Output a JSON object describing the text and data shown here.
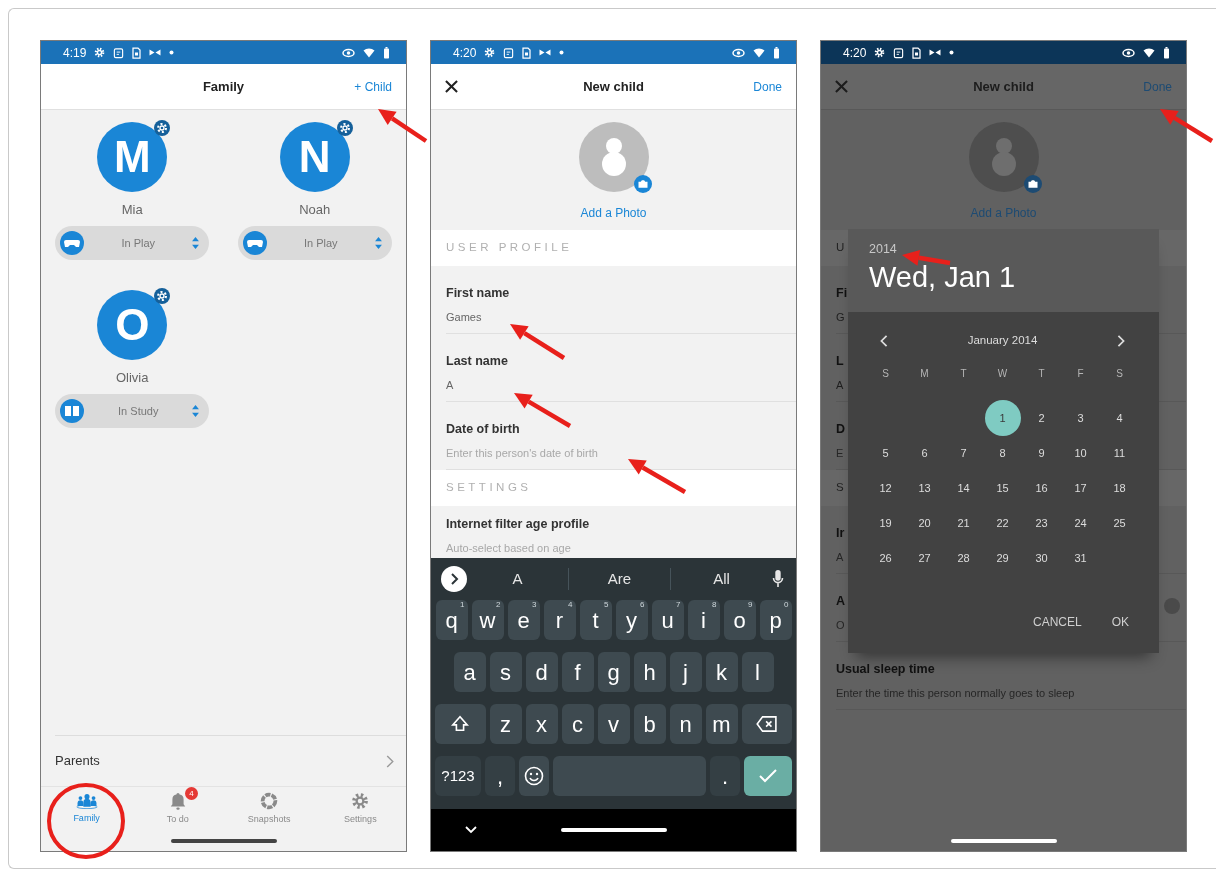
{
  "screens": [
    {
      "kind": "family",
      "status_bar": {
        "time": "4:19"
      },
      "header": {
        "title": "Family",
        "action": "+ Child"
      },
      "children": [
        {
          "initial": "M",
          "name": "Mia",
          "mode": "In Play",
          "kind": "play"
        },
        {
          "initial": "N",
          "name": "Noah",
          "mode": "In Play",
          "kind": "play"
        },
        {
          "initial": "O",
          "name": "Olivia",
          "mode": "In Study",
          "kind": "study"
        }
      ],
      "footer_link": "Parents",
      "bottom_nav": [
        {
          "label": "Family",
          "kind": "family",
          "selected": true
        },
        {
          "label": "To do",
          "kind": "todo",
          "selected": false,
          "badge": "4"
        },
        {
          "label": "Snapshots",
          "kind": "snapshots",
          "selected": false
        },
        {
          "label": "Settings",
          "kind": "settings",
          "selected": false
        }
      ]
    },
    {
      "kind": "form",
      "status_bar": {
        "time": "4:20"
      },
      "header": {
        "title": "New child",
        "action": "Done"
      },
      "photo_label": "Add a Photo",
      "sections": [
        {
          "heading": "USER PROFILE",
          "fields": [
            {
              "kind": "text",
              "label": "First name",
              "value": "Games"
            },
            {
              "kind": "text",
              "label": "Last name",
              "value": "A"
            },
            {
              "kind": "text",
              "label": "Date of birth",
              "placeholder": "Enter this person's date of birth"
            }
          ]
        },
        {
          "heading": "SETTINGS",
          "fields": [
            {
              "kind": "text",
              "label": "Internet filter age profile",
              "placeholder": "Auto-select based on age"
            }
          ]
        }
      ],
      "keyboard": {
        "suggestions": [
          "A",
          "Are",
          "All"
        ],
        "rows": [
          [
            {
              "kind": "char",
              "label": "q",
              "hint": "1"
            },
            {
              "kind": "char",
              "label": "w",
              "hint": "2"
            },
            {
              "kind": "char",
              "label": "e",
              "hint": "3"
            },
            {
              "kind": "char",
              "label": "r",
              "hint": "4"
            },
            {
              "kind": "char",
              "label": "t",
              "hint": "5"
            },
            {
              "kind": "char",
              "label": "y",
              "hint": "6"
            },
            {
              "kind": "char",
              "label": "u",
              "hint": "7"
            },
            {
              "kind": "char",
              "label": "i",
              "hint": "8"
            },
            {
              "kind": "char",
              "label": "o",
              "hint": "9"
            },
            {
              "kind": "char",
              "label": "p",
              "hint": "0"
            }
          ],
          [
            {
              "kind": "char",
              "label": "a"
            },
            {
              "kind": "char",
              "label": "s"
            },
            {
              "kind": "char",
              "label": "d"
            },
            {
              "kind": "char",
              "label": "f"
            },
            {
              "kind": "char",
              "label": "g"
            },
            {
              "kind": "char",
              "label": "h"
            },
            {
              "kind": "char",
              "label": "j"
            },
            {
              "kind": "char",
              "label": "k"
            },
            {
              "kind": "char",
              "label": "l"
            }
          ],
          [
            {
              "kind": "shift"
            },
            {
              "kind": "char",
              "label": "z"
            },
            {
              "kind": "char",
              "label": "x"
            },
            {
              "kind": "char",
              "label": "c"
            },
            {
              "kind": "char",
              "label": "v"
            },
            {
              "kind": "char",
              "label": "b"
            },
            {
              "kind": "char",
              "label": "n"
            },
            {
              "kind": "char",
              "label": "m"
            },
            {
              "kind": "backspace"
            }
          ]
        ],
        "bottom_row": {
          "symbols": "?123",
          "comma": ",",
          "period": "."
        }
      }
    },
    {
      "kind": "date_picker",
      "status_bar": {
        "time": "4:20"
      },
      "header": {
        "title": "New child",
        "action": "Done"
      },
      "photo_label": "Add a Photo",
      "sections": [
        {
          "heading": "U",
          "fields": [
            {
              "kind": "text",
              "label": "Fi",
              "value": "G"
            },
            {
              "kind": "text",
              "label": "L",
              "value": "A"
            },
            {
              "kind": "text",
              "label": "D",
              "placeholder": "E"
            }
          ]
        },
        {
          "heading": "S",
          "fields": [
            {
              "kind": "text",
              "label": "Ir",
              "placeholder": "A"
            },
            {
              "kind": "toggle",
              "label": "A",
              "placeholder": "O",
              "on": false
            },
            {
              "kind": "text",
              "label": "Usual sleep time",
              "placeholder": "Enter the time this person normally goes to sleep"
            }
          ]
        }
      ],
      "dialog": {
        "year": "2014",
        "date": "Wed, Jan 1",
        "month": "January 2014",
        "weekdays": [
          "S",
          "M",
          "T",
          "W",
          "T",
          "F",
          "S"
        ],
        "days": [
          {
            "kind": "blank"
          },
          {
            "kind": "blank"
          },
          {
            "kind": "blank"
          },
          {
            "kind": "day",
            "label": "1",
            "selected": true
          },
          {
            "kind": "day",
            "label": "2",
            "selected": false
          },
          {
            "kind": "day",
            "label": "3",
            "selected": false
          },
          {
            "kind": "day",
            "label": "4",
            "selected": false
          },
          {
            "kind": "day",
            "label": "5",
            "selected": false
          },
          {
            "kind": "day",
            "label": "6",
            "selected": false
          },
          {
            "kind": "day",
            "label": "7",
            "selected": false
          },
          {
            "kind": "day",
            "label": "8",
            "selected": false
          },
          {
            "kind": "day",
            "label": "9",
            "selected": false
          },
          {
            "kind": "day",
            "label": "10",
            "selected": false
          },
          {
            "kind": "day",
            "label": "11",
            "selected": false
          },
          {
            "kind": "day",
            "label": "12",
            "selected": false
          },
          {
            "kind": "day",
            "label": "13",
            "selected": false
          },
          {
            "kind": "day",
            "label": "14",
            "selected": false
          },
          {
            "kind": "day",
            "label": "15",
            "selected": false
          },
          {
            "kind": "day",
            "label": "16",
            "selected": false
          },
          {
            "kind": "day",
            "label": "17",
            "selected": false
          },
          {
            "kind": "day",
            "label": "18",
            "selected": false
          },
          {
            "kind": "day",
            "label": "19",
            "selected": false
          },
          {
            "kind": "day",
            "label": "20",
            "selected": false
          },
          {
            "kind": "day",
            "label": "21",
            "selected": false
          },
          {
            "kind": "day",
            "label": "22",
            "selected": false
          },
          {
            "kind": "day",
            "label": "23",
            "selected": false
          },
          {
            "kind": "day",
            "label": "24",
            "selected": false
          },
          {
            "kind": "day",
            "label": "25",
            "selected": false
          },
          {
            "kind": "day",
            "label": "26",
            "selected": false
          },
          {
            "kind": "day",
            "label": "27",
            "selected": false
          },
          {
            "kind": "day",
            "label": "28",
            "selected": false
          },
          {
            "kind": "day",
            "label": "29",
            "selected": false
          },
          {
            "kind": "day",
            "label": "30",
            "selected": false
          },
          {
            "kind": "day",
            "label": "31",
            "selected": false
          }
        ],
        "buttons": [
          "CANCEL",
          "OK"
        ]
      }
    }
  ],
  "annotations": [
    {
      "kind": "arrow"
    },
    {
      "kind": "circle"
    },
    {
      "kind": "arrow"
    },
    {
      "kind": "arrow"
    },
    {
      "kind": "arrow"
    },
    {
      "kind": "arrow"
    },
    {
      "kind": "arrow"
    }
  ]
}
